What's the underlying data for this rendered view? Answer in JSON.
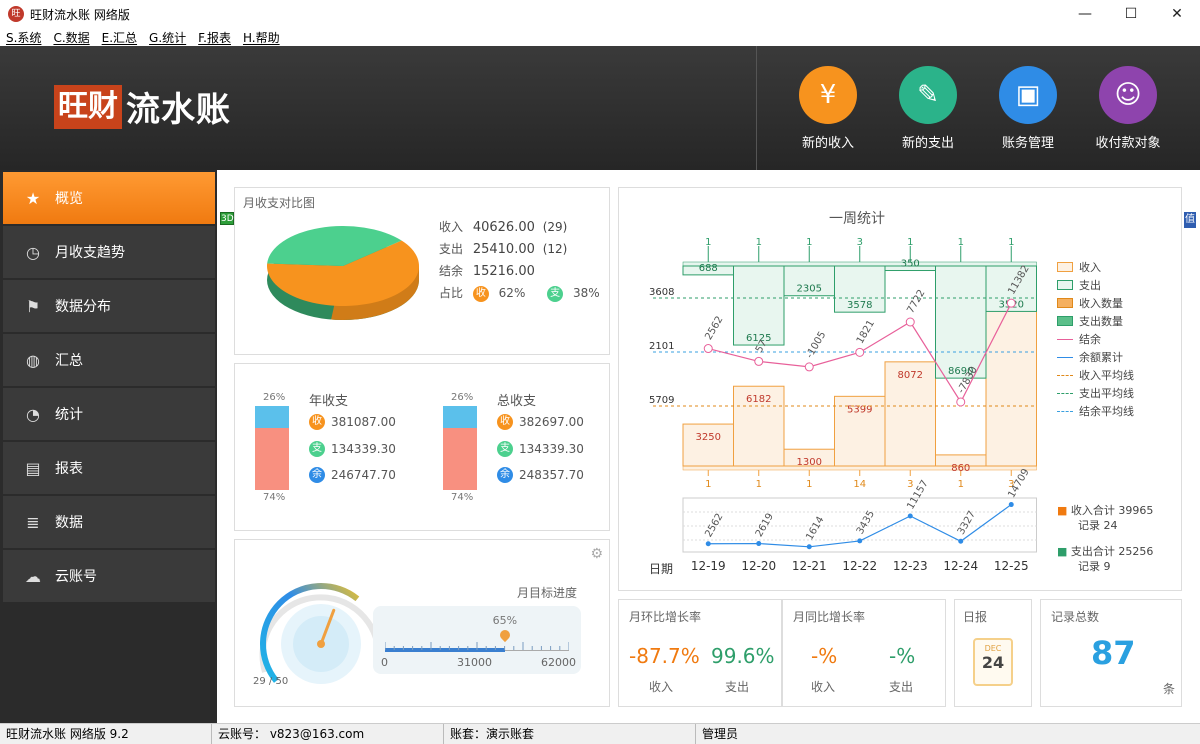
{
  "window": {
    "title": "旺财流水账 网络版",
    "minimize": "—",
    "maximize": "☐",
    "close": "✕"
  },
  "menu": [
    "S.系统",
    "C.数据",
    "E.汇总",
    "G.统计",
    "F.报表",
    "H.帮助"
  ],
  "logo": {
    "box": "旺财",
    "text": "流水账"
  },
  "quick_actions": [
    {
      "label": "新的收入",
      "color": "#f7931e",
      "icon": "yen-icon",
      "glyph": "¥"
    },
    {
      "label": "新的支出",
      "color": "#2bb38a",
      "icon": "edit-icon",
      "glyph": "✎"
    },
    {
      "label": "账务管理",
      "color": "#2f8ce6",
      "icon": "wallet-icon",
      "glyph": "▣"
    },
    {
      "label": "收付款对象",
      "color": "#8e44ad",
      "icon": "contact-icon",
      "glyph": "☺"
    }
  ],
  "sidebar": [
    {
      "label": "概览",
      "icon": "star-icon",
      "glyph": "★"
    },
    {
      "label": "月收支趋势",
      "icon": "clock-icon",
      "glyph": "◷"
    },
    {
      "label": "数据分布",
      "icon": "flag-icon",
      "glyph": "⚑"
    },
    {
      "label": "汇总",
      "icon": "circles-icon",
      "glyph": "◍"
    },
    {
      "label": "统计",
      "icon": "pie-icon",
      "glyph": "◔"
    },
    {
      "label": "报表",
      "icon": "document-icon",
      "glyph": "▤"
    },
    {
      "label": "数据",
      "icon": "database-icon",
      "glyph": "≣"
    },
    {
      "label": "云账号",
      "icon": "cloud-icon",
      "glyph": "☁"
    }
  ],
  "pie_panel": {
    "title": "月收支对比图",
    "badge_3d": "3D",
    "income_label": "收入",
    "income_value": "40626.00",
    "income_count": "(29)",
    "expense_label": "支出",
    "expense_value": "25410.00",
    "expense_count": "(12)",
    "balance_label": "结余",
    "balance_value": "15216.00",
    "ratio_label": "占比",
    "ratio_in_badge": "收",
    "ratio_in": "62%",
    "ratio_out_badge": "支",
    "ratio_out": "38%",
    "income_fraction": 0.62,
    "income_color": "#f7931e",
    "expense_color": "#4cd08e"
  },
  "annual_panel": {
    "year": {
      "title": "年收支",
      "top_pct": "26%",
      "bottom_pct": "74%",
      "in_badge": "收",
      "in": "381087.00",
      "out_badge": "支",
      "out": "134339.30",
      "bal_badge": "余",
      "bal": "246747.70",
      "top_fraction": 0.26
    },
    "total": {
      "title": "总收支",
      "top_pct": "26%",
      "bottom_pct": "74%",
      "in_badge": "收",
      "in": "382697.00",
      "out_badge": "支",
      "out": "134339.30",
      "bal_badge": "余",
      "bal": "248357.70",
      "top_fraction": 0.26
    },
    "top_color": "#5bc0eb",
    "bottom_color": "#f89080"
  },
  "gauge_panel": {
    "title": "月目标进度",
    "count": "29 / 50",
    "pct": "65%",
    "progress_fraction": 0.65,
    "needle_fraction": 0.58,
    "scale": [
      "0",
      "31000",
      "62000"
    ]
  },
  "week_chart": {
    "title": "一周统计",
    "value_badge": "值",
    "date_label": "日期",
    "dates": [
      "12-19",
      "12-20",
      "12-21",
      "12-22",
      "12-23",
      "12-24",
      "12-25"
    ],
    "income": [
      3250,
      6182,
      1300,
      5399,
      8072,
      860,
      14902
    ],
    "expense": [
      688,
      6125,
      2305,
      3578,
      350,
      8690,
      3520
    ],
    "balance": [
      2562,
      57,
      -1005,
      1821,
      7722,
      -7830,
      11382
    ],
    "balance_labels": [
      "2562",
      "57",
      "-1005",
      "1821",
      "7722",
      "-7830",
      "11382"
    ],
    "income_counts": [
      "1",
      "1",
      "1",
      "14",
      "3",
      "1",
      "3"
    ],
    "expense_counts": [
      "1",
      "1",
      "1",
      "3",
      "1",
      "1",
      "1"
    ],
    "avg_labels": {
      "expense": "3608",
      "balance": "2101",
      "income": "5709"
    },
    "cumulative": [
      2562,
      2619,
      1614,
      3435,
      11157,
      3327,
      14709
    ],
    "cumulative_labels": [
      "2562",
      "2619",
      "1614",
      "3435",
      "11157",
      "3327",
      "14709"
    ],
    "legend": [
      "收入",
      "支出",
      "收入数量",
      "支出数量",
      "结余",
      "余额累计",
      "收入平均线",
      "支出平均线",
      "结余平均线"
    ],
    "colors": {
      "income": "#f0a040",
      "expense": "#2e9e6a",
      "balance": "#e8609a",
      "cum": "#2f8ce6",
      "inc_avg": "#e0891a",
      "exp_avg": "#2e9e6a",
      "bal_avg": "#3aa0e0"
    },
    "summary": {
      "in_label": "收入合计",
      "in_total": "39965",
      "in_rec_label": "记录",
      "in_rec": "24",
      "out_label": "支出合计",
      "out_total": "25256",
      "out_rec_label": "记录",
      "out_rec": "9"
    }
  },
  "mom": {
    "title": "月环比增长率",
    "in": "-87.7%",
    "out": "99.6%",
    "in_label": "收入",
    "out_label": "支出"
  },
  "yoy": {
    "title": "月同比增长率",
    "in": "-%",
    "out": "-%",
    "in_label": "收入",
    "out_label": "支出"
  },
  "daily": {
    "title": "日报",
    "month": "DEC",
    "day": "24"
  },
  "records": {
    "title": "记录总数",
    "count": "87",
    "unit": "条"
  },
  "status": {
    "version": "旺财流水账 网络版 9.2",
    "cloud": "云账号： v823@163.com",
    "book": "账套：演示账套",
    "user": "管理员"
  }
}
